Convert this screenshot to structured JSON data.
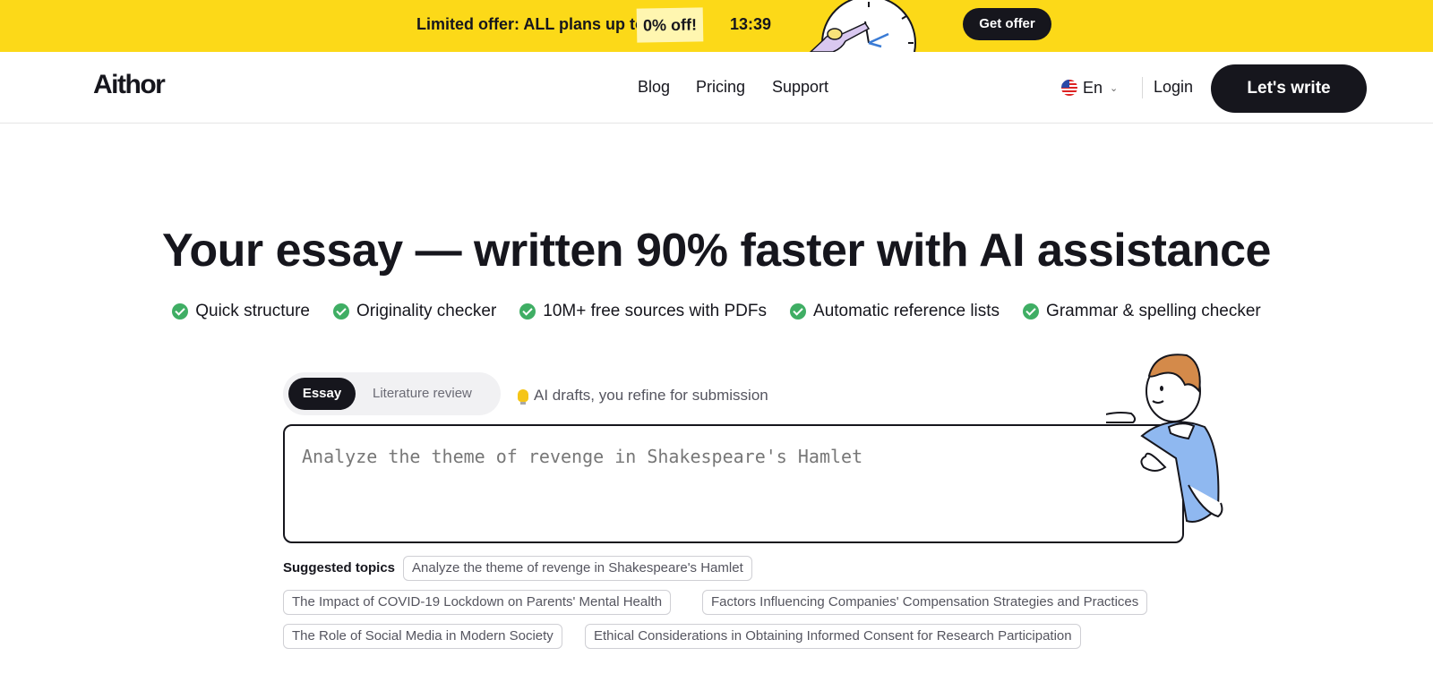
{
  "promo": {
    "text": "Limited offer: ALL plans up to",
    "highlight": "0% off!",
    "timer": "13:39",
    "button": "Get offer"
  },
  "header": {
    "logo": "Aithor",
    "nav": [
      "Blog",
      "Pricing",
      "Support"
    ],
    "language": "En",
    "login": "Login",
    "cta": "Let's write"
  },
  "hero": {
    "title": "Your essay — written 90% faster with AI assistance",
    "features": [
      "Quick structure",
      "Originality checker",
      "10M+ free sources with PDFs",
      "Automatic reference lists",
      "Grammar & spelling checker"
    ]
  },
  "modes": {
    "active": "Essay",
    "other": "Literature review",
    "hint": "AI drafts, you refine for submission"
  },
  "topic_input": {
    "placeholder": "Analyze the theme of revenge in Shakespeare's Hamlet"
  },
  "suggestions": {
    "label": "Suggested topics",
    "items": [
      "Analyze the theme of revenge in Shakespeare's Hamlet",
      "The Impact of COVID-19 Lockdown on Parents' Mental Health",
      "Factors Influencing Companies' Compensation Strategies and Practices",
      "The Role of Social Media in Modern Society",
      "Ethical Considerations in Obtaining Informed Consent for Research Participation"
    ]
  },
  "colors": {
    "banner": "#fcd918",
    "dark": "#16161d",
    "check": "#3fae64"
  }
}
